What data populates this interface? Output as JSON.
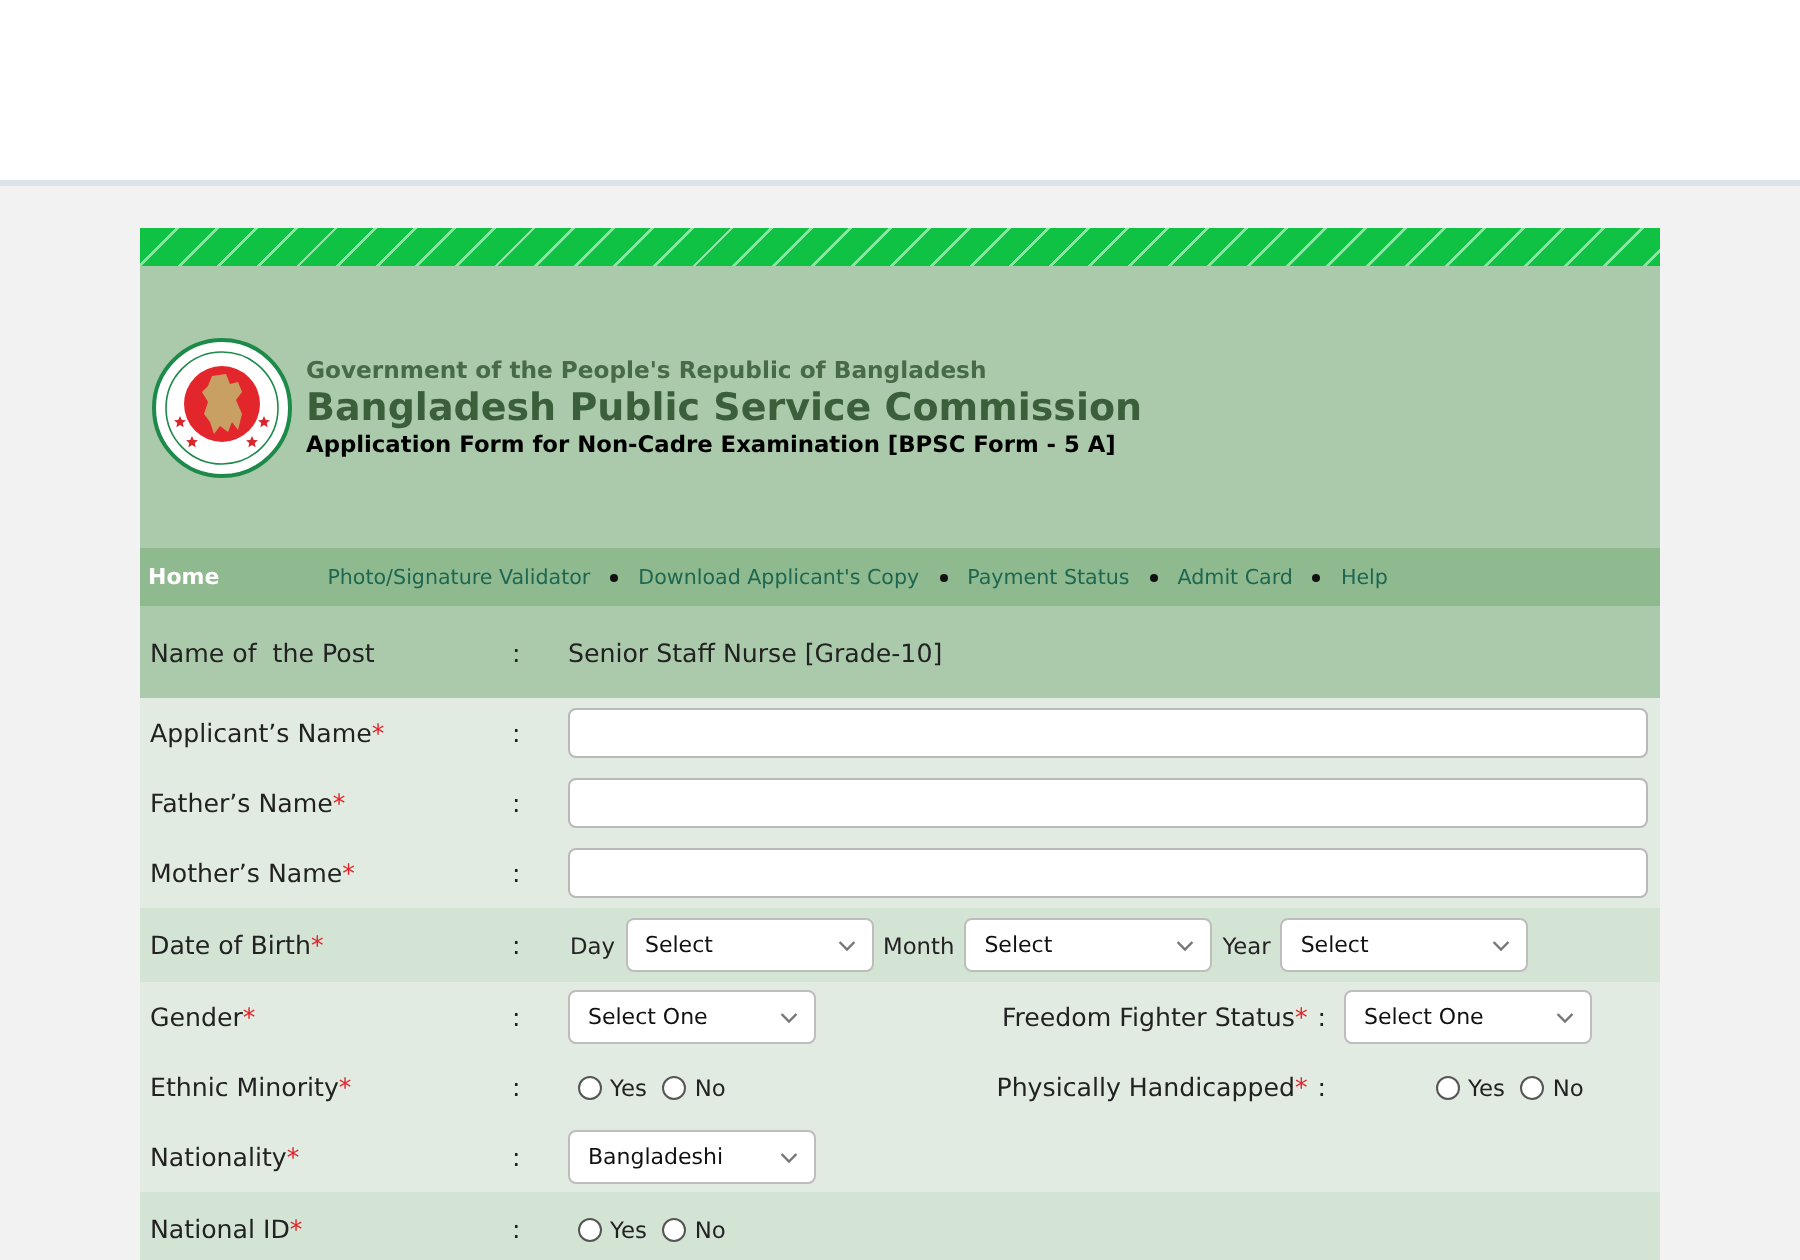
{
  "header": {
    "government": "Government of the People's Republic of Bangladesh",
    "commission": "Bangladesh Public Service Commission",
    "form_title": "Application Form for Non-Cadre Examination [BPSC Form - 5 A]"
  },
  "nav": {
    "home": {
      "label": "Home",
      "selected": true
    },
    "links": [
      {
        "label": "Photo/Signature Validator",
        "selected": false
      },
      {
        "label": "Download Applicant's Copy",
        "selected": false
      },
      {
        "label": "Payment Status",
        "selected": false
      },
      {
        "label": "Admit Card",
        "selected": false
      },
      {
        "label": "Help",
        "selected": false
      }
    ]
  },
  "post": {
    "label": "Name of  the Post",
    "colon": ":",
    "value": "Senior Staff Nurse [Grade-10]"
  },
  "sections": [
    {
      "rows": [
        {
          "kind": "text",
          "label": "Applicant’s Name",
          "mark": "*",
          "colon": ":"
        },
        {
          "kind": "text",
          "label": "Father’s Name",
          "mark": "*",
          "colon": ":"
        },
        {
          "kind": "text",
          "label": "Mother’s Name",
          "mark": "*",
          "colon": ":"
        }
      ]
    },
    {
      "rows": [
        {
          "kind": "date",
          "label": "Date of Birth",
          "mark": "*",
          "colon": ":",
          "parts": [
            {
              "label": "Day",
              "value": "Select"
            },
            {
              "label": "Month",
              "value": "Select"
            },
            {
              "label": "Year",
              "value": "Select"
            }
          ]
        }
      ]
    },
    {
      "rows": [
        {
          "kind": "select",
          "label": "Gender",
          "mark": "*",
          "colon": ":",
          "value": "Select One",
          "right": {
            "kind": "select",
            "label": "Freedom Fighter Status",
            "mark": "*",
            "colon": ":",
            "value": "Select One"
          }
        },
        {
          "kind": "radio",
          "label": "Ethnic Minority",
          "mark": "*",
          "colon": ":",
          "options": [
            {
              "label": "Yes",
              "selected": false
            },
            {
              "label": "No",
              "selected": false
            }
          ],
          "right": {
            "kind": "radio",
            "label": "Physically Handicapped",
            "mark": "*",
            "colon": ":",
            "options": [
              {
                "label": "Yes",
                "selected": false
              },
              {
                "label": "No",
                "selected": false
              }
            ]
          }
        },
        {
          "kind": "select",
          "label": "Nationality",
          "mark": "*",
          "colon": ":",
          "value": "Bangladeshi"
        }
      ]
    },
    {
      "rows": [
        {
          "kind": "radio",
          "label": "National ID",
          "mark": "*",
          "colon": ":",
          "options": [
            {
              "label": "Yes",
              "selected": false
            },
            {
              "label": "No",
              "selected": false
            }
          ]
        }
      ]
    }
  ]
}
